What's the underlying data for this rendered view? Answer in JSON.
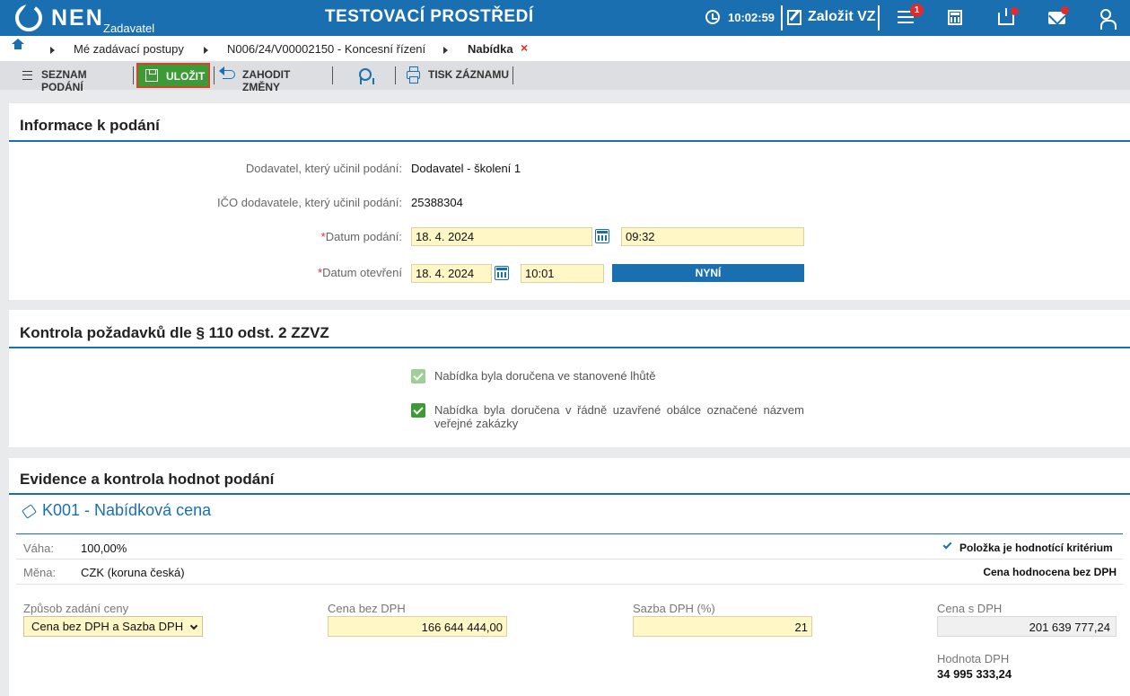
{
  "topbar": {
    "logo": "NEN",
    "logo_sub": "Zadavatel",
    "env_title": "TESTOVACÍ PROSTŘEDÍ",
    "time": "10:02:59",
    "create_label": "Založit VZ",
    "menu_badge": "1",
    "icons": [
      "clock-icon",
      "edit-icon",
      "menu-icon",
      "calculator-icon",
      "inbox-icon",
      "mail-icon",
      "user-icon"
    ]
  },
  "breadcrumb": {
    "items": [
      "Mé zadávací postupy",
      "N006/24/V00002150 - Koncesní řízení",
      "Nabídka"
    ],
    "close": "×"
  },
  "toolbar": {
    "list_label": "SEZNAM PODÁNÍ",
    "save_label": "ULOŽIT",
    "discard_label": "ZAHODIT ZMĚNY",
    "print_label": "TISK ZÁZNAMU"
  },
  "info": {
    "title": "Informace k podání",
    "supplier_label": "Dodavatel, který učinil podání:",
    "supplier_value": "Dodavatel - školení 1",
    "ico_label": "IČO dodavatele, který učinil podání:",
    "ico_value": "25388304",
    "required_mark": "*",
    "submit_label": "Datum podání:",
    "submit_date": "18. 4. 2024",
    "submit_time": "09:32",
    "open_label": "Datum otevření",
    "open_date": "18. 4. 2024",
    "open_time": "10:01",
    "now_button": "NYNÍ"
  },
  "check": {
    "title": "Kontrola požadavků dle § 110 odst. 2 ZZVZ",
    "items": [
      {
        "text": "Nabídka byla doručena ve stanovené lhůtě",
        "checked": true,
        "enabled": false
      },
      {
        "text": "Nabídka byla doručena v řádně uzavřené obálce označené názvem veřejné zakázky",
        "checked": true,
        "enabled": true
      }
    ]
  },
  "evidence": {
    "title": "Evidence a kontrola hodnot podání",
    "criterion_title": "K001 - Nabídková cena",
    "weight_label": "Váha:",
    "weight_value": "100,00%",
    "currency_label": "Měna:",
    "currency_value": "CZK (koruna česká)",
    "criterion_flag": "Položka je hodnotící kritérium",
    "evaluated_note": "Cena hodnocena bez DPH",
    "price_mode_label": "Způsob zadání ceny",
    "price_mode_value": "Cena bez DPH a Sazba DPH",
    "price_net_label": "Cena bez DPH",
    "price_net_value": "166 644 444,00",
    "vat_rate_label": "Sazba DPH (%)",
    "vat_rate_value": "21",
    "price_gross_label": "Cena s DPH",
    "price_gross_value": "201 639 777,24",
    "vat_value_label": "Hodnota DPH",
    "vat_value": "34 995 333,24"
  },
  "colors": {
    "brand": "#1a6fb0",
    "save_green": "#3d9b35",
    "check_green": "#3d9b35",
    "input_yellow": "#fff7c6",
    "alert_red": "#e02b2b"
  }
}
